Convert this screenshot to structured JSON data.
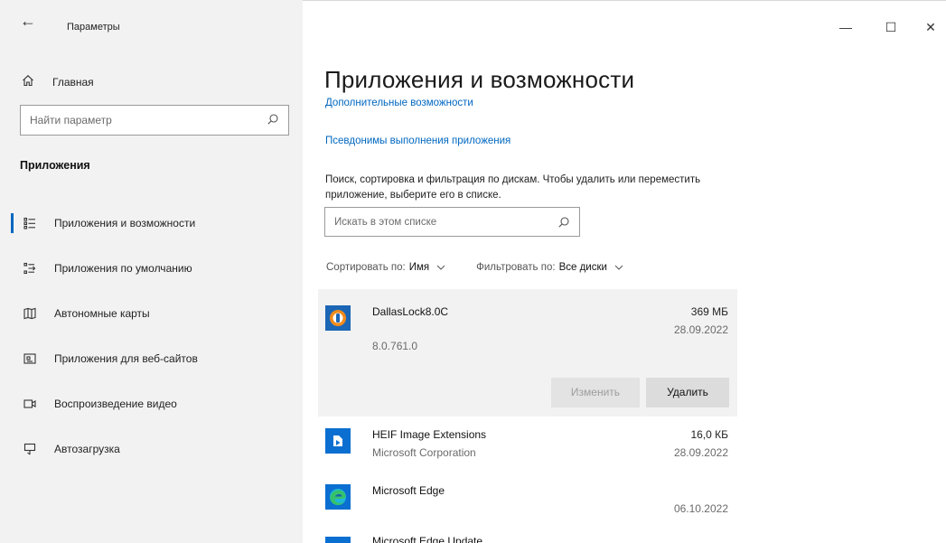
{
  "window": {
    "title": "Параметры",
    "back_glyph": "←",
    "controls": {
      "minimize": "—",
      "maximize": "☐",
      "close": "✕"
    }
  },
  "sidebar": {
    "home_label": "Главная",
    "search_placeholder": "Найти параметр",
    "section_title": "Приложения",
    "items": [
      {
        "label": "Приложения и возможности",
        "icon": "apps-features-icon",
        "active": true
      },
      {
        "label": "Приложения по умолчанию",
        "icon": "default-apps-icon",
        "active": false
      },
      {
        "label": "Автономные карты",
        "icon": "offline-maps-icon",
        "active": false
      },
      {
        "label": "Приложения для веб-сайтов",
        "icon": "apps-for-websites-icon",
        "active": false
      },
      {
        "label": "Воспроизведение видео",
        "icon": "video-playback-icon",
        "active": false
      },
      {
        "label": "Автозагрузка",
        "icon": "startup-icon",
        "active": false
      }
    ]
  },
  "main": {
    "title": "Приложения и возможности",
    "link_optional_features": "Дополнительные возможности",
    "link_execution_aliases": "Псевдонимы выполнения приложения",
    "description": "Поиск, сортировка и фильтрация по дискам. Чтобы удалить или переместить приложение, выберите его в списке.",
    "list_search_placeholder": "Искать в этом списке",
    "sort_label": "Сортировать по:",
    "sort_value": "Имя",
    "filter_label": "Фильтровать по:",
    "filter_value": "Все диски",
    "apps": [
      {
        "name": "DallasLock8.0C",
        "publisher": "",
        "size": "369 МБ",
        "date": "28.09.2022",
        "version": "8.0.761.0",
        "selected": true
      },
      {
        "name": "HEIF Image Extensions",
        "publisher": "Microsoft Corporation",
        "size": "16,0 КБ",
        "date": "28.09.2022"
      },
      {
        "name": "Microsoft Edge",
        "publisher": "",
        "size": "",
        "date": "06.10.2022"
      },
      {
        "name": "Microsoft Edge Update",
        "publisher": "",
        "size": "",
        "date": ""
      }
    ],
    "buttons": {
      "modify": "Изменить",
      "remove": "Удалить"
    }
  },
  "colors": {
    "accent": "#0067c0",
    "sidebar_bg": "#f2f2f2",
    "selected_row_bg": "#f2f2f2"
  }
}
